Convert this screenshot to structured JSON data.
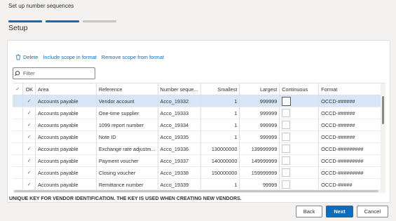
{
  "wizard": {
    "title": "Set up number sequences",
    "step_title": "Setup"
  },
  "progress": {
    "steps_total": 3,
    "steps_done": 2
  },
  "toolbar": {
    "delete_label": "Delete",
    "include_label": "Include scope in format",
    "remove_label": "Remove scope from format"
  },
  "filter": {
    "placeholder": "Filter",
    "icon": "search-icon"
  },
  "grid": {
    "headers": {
      "check": "✓",
      "ok": "OK",
      "area": "Area",
      "reference": "Reference",
      "number_sequence": "Number seque...",
      "smallest": "Smallest",
      "largest": "Largest",
      "continuous": "Continuous",
      "format": "Format"
    },
    "rows": [
      {
        "ok": "✓",
        "area": "Accounts payable",
        "reference": "Vendor account",
        "number_sequence": "Acco_19332",
        "smallest": "1",
        "largest": "999999",
        "format": "OCCD-######",
        "selected": true
      },
      {
        "ok": "✓",
        "area": "Accounts payable",
        "reference": "One-time supplier",
        "number_sequence": "Acco_19333",
        "smallest": "1",
        "largest": "999999",
        "format": "OCCD-######",
        "selected": false
      },
      {
        "ok": "✓",
        "area": "Accounts payable",
        "reference": "1099 report number",
        "number_sequence": "Acco_19334",
        "smallest": "1",
        "largest": "999999",
        "format": "OCCD-######",
        "selected": false
      },
      {
        "ok": "✓",
        "area": "Accounts payable",
        "reference": "Note ID",
        "number_sequence": "Acco_19335",
        "smallest": "1",
        "largest": "999999",
        "format": "OCCD-######",
        "selected": false
      },
      {
        "ok": "✓",
        "area": "Accounts payable",
        "reference": "Exchange rate adjustm...",
        "number_sequence": "Acco_19336",
        "smallest": "130000000",
        "largest": "139999999",
        "format": "OCCD-#########",
        "selected": false
      },
      {
        "ok": "✓",
        "area": "Accounts payable",
        "reference": "Payment voucher",
        "number_sequence": "Acco_19337",
        "smallest": "140000000",
        "largest": "149999999",
        "format": "OCCD-#########",
        "selected": false
      },
      {
        "ok": "✓",
        "area": "Accounts payable",
        "reference": "Closing voucher",
        "number_sequence": "Acco_19338",
        "smallest": "150000000",
        "largest": "159999999",
        "format": "OCCD-#########",
        "selected": false
      },
      {
        "ok": "✓",
        "area": "Accounts payable",
        "reference": "Remittance number",
        "number_sequence": "Acco_19339",
        "smallest": "1",
        "largest": "99999",
        "format": "OCCD-#####",
        "selected": false
      }
    ]
  },
  "help_text": "UNIQUE KEY FOR VENDOR IDENTIFICATION. THE KEY IS USED WHEN CREATING NEW VENDORS.",
  "buttons": {
    "back": "Back",
    "next": "Next",
    "cancel": "Cancel"
  },
  "colors": {
    "accent": "#0f6cbd",
    "selected_row": "#d7e6f6"
  }
}
